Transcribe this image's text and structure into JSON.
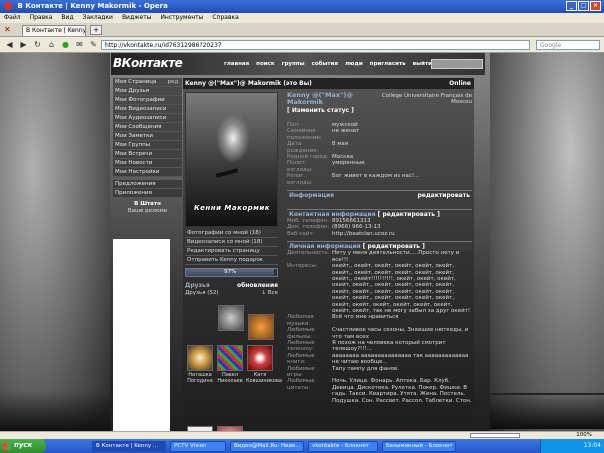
{
  "window": {
    "title": "В Контакте | Kenny Makormik - Opera",
    "buttons": [
      "_",
      "□",
      "×"
    ]
  },
  "menu": [
    "Файл",
    "Правка",
    "Вид",
    "Закладки",
    "Виджеты",
    "Инструменты",
    "Справка"
  ],
  "tabs": [
    {
      "label": "В Контакте | Kenny Ma..."
    }
  ],
  "address": {
    "url": "http://vkontakte.ru/id76312986?20237",
    "search_placeholder": "Google"
  },
  "site": {
    "logo": "ВКонтакте",
    "nav": [
      "главная",
      "поиск",
      "группы",
      "события",
      "люди",
      "пригласить",
      "выйти"
    ]
  },
  "left_menu": {
    "edit_label": "ред.",
    "items": [
      "Моя Страница",
      "Мои Друзья",
      "Мои Фотографии",
      "Мои Видеозаписи",
      "Мои Аудиозаписи",
      "Мои Сообщения",
      "Мои Заметки",
      "Мои Группы",
      "Мои Встречи",
      "Мои Новости",
      "Мои Настройки"
    ],
    "extra": [
      "Предложения",
      "Приложения"
    ],
    "ad_title": "В Штатн",
    "ad_sub": "Ваше резюме"
  },
  "profile": {
    "header": "Kenny @(\"Max\")@ Makormik (это Вы)",
    "online": "Online",
    "name": "Kenny @(\"Max\")@ Makormik",
    "university": "Collège Universitaire Français de Moscou",
    "change_status": "[ Изменить статус ]",
    "photo_caption": "Кенни Макормик",
    "links": [
      "Фотографии со мной (18)",
      "Видеозаписи со мной (18)",
      "Редактировать страницу",
      "Отправить Kenny подарок"
    ],
    "rating": "97%",
    "basic": [
      {
        "k": "Пол:",
        "v": "мужской"
      },
      {
        "k": "Семейное положение:",
        "v": "не женат"
      },
      {
        "k": "Дата рождения:",
        "v": "8 мая"
      },
      {
        "k": "Родной город:",
        "v": "Москва"
      },
      {
        "k": "Полит. взгляды:",
        "v": "умеренные"
      },
      {
        "k": "Религ. взгляды:",
        "v": "Бог живет в каждом из нас!..."
      }
    ],
    "info_head": "Информация",
    "edit_label": "редактировать",
    "contact_head": "Контактная информация",
    "contact_edit": "[ редактировать ]",
    "contact": [
      {
        "k": "Моб. телефон:",
        "v": "89156661313"
      },
      {
        "k": "Дом. телефон:",
        "v": "(8966) 966-13-13"
      },
      {
        "k": "Веб-сайт:",
        "v": "http://beatclan.ucoz.ru"
      }
    ],
    "personal_head": "Личная информация",
    "personal_edit": "[ редактировать ]",
    "personal": [
      {
        "k": "Деятельность:",
        "v": "Нету у меня деятельности.....Просто нету и все!!!"
      },
      {
        "k": "Интересы:",
        "v": "окейт,, окейт, окейт, окейт, окейт, окейт, окейт,, окейт, окейт, окейт, окейт, окейт, окейт,, окейт!!!!!!!!!!, окейт, окейт, окейт, окейт, окейт,, окейт, окейт, окейт, окейт, окейт, окейт,, окейт, окейт, окейт, окейт, окейт, окейт,, окейт, окейт, окейт, окейт, окейт, окейт, окейт, окейт, окейт, окейт, окейт, окейт, так не могу забыл за друг окейт!"
      },
      {
        "k": "Любимая музыка:",
        "v": "Всё что мне нравиться"
      },
      {
        "k": "Любимые фильмы:",
        "v": "Счастливое часы сезоны, Знаешие нюткеды, и что там всех"
      },
      {
        "k": "Любимые телешоу:",
        "v": "Я похож на человека который смотрит телешоу?!!!..."
      },
      {
        "k": "Любимые книги:",
        "v": "аааааааа ааааааааааааааа так ааааааааааааа не читаю вообще..."
      },
      {
        "k": "Любимые игры:",
        "v": "Тапу тампу для фанов."
      },
      {
        "k": "Любимые цитаты:",
        "v": "Ночь. Улица. Фонарь. Аптека. Бар. Клуб. Девица. Дискотека. Рулетка. Покер. Фишки. В гадь. Такси. Квартира. Утята. Жена. Постель. Подушка. Сон. Рассвет. Рассол. Таблетки. Стон."
      }
    ],
    "friends_title": "Друзья",
    "friends_count": "Друзья (52)",
    "friends_updates": "обновления",
    "friends_all": "Все",
    "friends": [
      {
        "name": "Наташка Погодина",
        "color": "#d8a040"
      },
      {
        "name": "Павел Николаев",
        "color": "#8080a0"
      },
      {
        "name": "Катя Ковшиникова",
        "color": "#c84040"
      }
    ]
  },
  "taskbar": {
    "start": "пуск",
    "items": [
      {
        "label": "В Контакте | Kenny ...",
        "active": true
      },
      {
        "label": "PCTV Vision",
        "active": false
      },
      {
        "label": "Видео@Mail.Ru: Неав...",
        "active": false
      },
      {
        "label": "vkontakte - Блокнот",
        "active": false
      },
      {
        "label": "Безымянный - Блокнот",
        "active": false
      }
    ],
    "clock": "13:04"
  },
  "statusbar": {
    "zoom": "100%"
  }
}
